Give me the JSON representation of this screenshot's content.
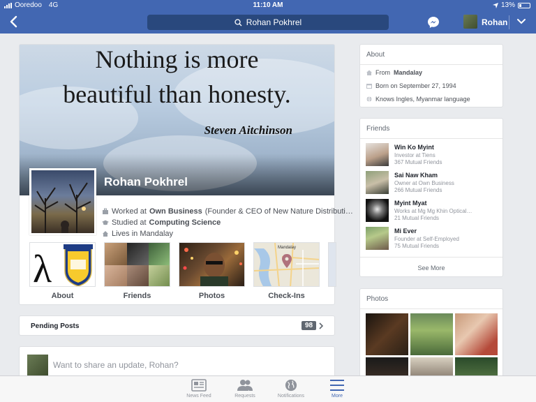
{
  "status_bar": {
    "carrier": "Ooredoo",
    "network": "4G",
    "time": "11:10 AM",
    "battery": "13%"
  },
  "nav": {
    "search_text": "Rohan Pokhrel",
    "user_name": "Rohan"
  },
  "profile": {
    "quote_line1": "Nothing is more",
    "quote_line2": "beautiful than honesty.",
    "quote_author": "Steven Aitchinson",
    "name": "Rohan Pokhrel",
    "work_prefix": "Worked at",
    "work_place": "Own Business",
    "work_detail": "(Founder & CEO of New Nature Distributi…",
    "study_prefix": "Studied at",
    "study_place": "Computing Science",
    "lives": "Lives in Mandalay"
  },
  "tiles": [
    {
      "label": "About"
    },
    {
      "label": "Friends"
    },
    {
      "label": "Photos"
    },
    {
      "label": "Check-Ins",
      "map_label": "Mandalay"
    }
  ],
  "pending": {
    "label": "Pending Posts",
    "count": "98"
  },
  "composer": {
    "placeholder": "Want to share an update, Rohan?"
  },
  "about": {
    "title": "About",
    "from_prefix": "From",
    "from_place": "Mandalay",
    "born": "Born on September 27, 1994",
    "languages": "Knows Ingles, Myanmar language"
  },
  "friends": {
    "title": "Friends",
    "items": [
      {
        "name": "Win Ko Myint",
        "sub": "Investor at Tiens",
        "mutual": "367 Mutual Friends"
      },
      {
        "name": "Sai Naw Kham",
        "sub": "Owner at Own Business",
        "mutual": "266 Mutual Friends"
      },
      {
        "name": "Myint Myat",
        "sub": "Works at Mg Mg Khin Optical…",
        "mutual": "21 Mutual Friends"
      },
      {
        "name": "Mi Ever",
        "sub": "Founder at Self-Employed",
        "mutual": "75 Mutual Friends"
      }
    ],
    "see_more": "See More"
  },
  "photos": {
    "title": "Photos"
  },
  "tabbar": [
    {
      "label": "News Feed",
      "icon": "news-feed-icon"
    },
    {
      "label": "Requests",
      "icon": "friend-requests-icon"
    },
    {
      "label": "Notifications",
      "icon": "globe-icon"
    },
    {
      "label": "More",
      "icon": "hamburger-icon"
    }
  ],
  "colors": {
    "brand": "#4267b2",
    "search_bg": "#29487d",
    "page_bg": "#e9ebee"
  }
}
